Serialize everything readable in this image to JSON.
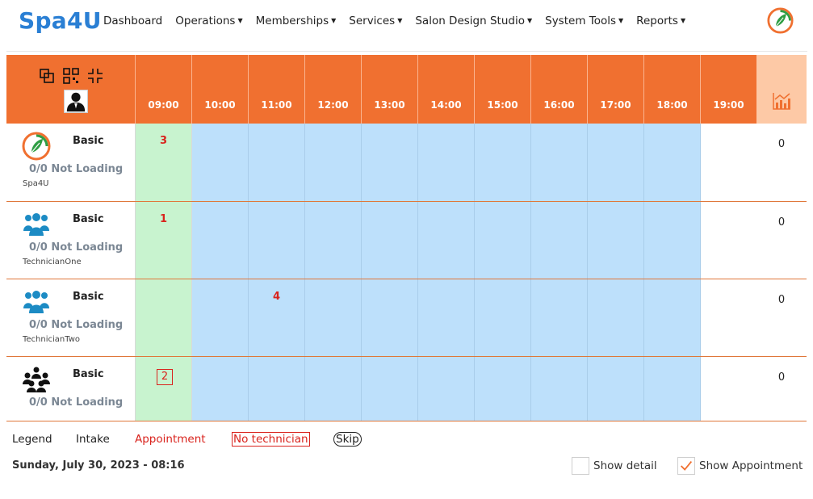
{
  "nav": {
    "brand": "Spa4U",
    "items": [
      "Dashboard",
      "Operations",
      "Memberships",
      "Services",
      "Salon Design Studio",
      "System Tools",
      "Reports"
    ],
    "dropdown": [
      false,
      true,
      true,
      true,
      true,
      true,
      true
    ]
  },
  "schedule": {
    "hours": [
      "09:00",
      "10:00",
      "11:00",
      "12:00",
      "13:00",
      "14:00",
      "15:00",
      "16:00",
      "17:00",
      "18:00",
      "19:00"
    ],
    "rows": [
      {
        "plan": "Basic",
        "status": "0/0 Not Loading",
        "name": "Spa4U",
        "avatar": "spa4u-logo-icon",
        "total": "0",
        "marks": [
          {
            "hour": "09:00",
            "value": "3",
            "style": "appointment"
          }
        ]
      },
      {
        "plan": "Basic",
        "status": "0/0 Not Loading",
        "name": "TechnicianOne",
        "avatar": "group-blue-icon",
        "total": "0",
        "marks": [
          {
            "hour": "09:00",
            "value": "1",
            "style": "appointment"
          }
        ]
      },
      {
        "plan": "Basic",
        "status": "0/0 Not Loading",
        "name": "TechnicianTwo",
        "avatar": "group-blue-icon",
        "total": "0",
        "marks": [
          {
            "hour": "11:00",
            "value": "4",
            "style": "appointment"
          }
        ]
      },
      {
        "plan": "Basic",
        "status": "0/0 Not Loading",
        "name": "",
        "avatar": "group-black-icon",
        "total": "0",
        "marks": [
          {
            "hour": "09:00",
            "value": "2",
            "style": "no-technician"
          }
        ]
      }
    ]
  },
  "legend": {
    "title": "Legend",
    "intake": "Intake",
    "appointment": "Appointment",
    "no_technician": "No technician",
    "skip": "Skip"
  },
  "footer": {
    "datetime": "Sunday, July 30, 2023 - 08:16",
    "show_detail": "Show detail",
    "show_detail_checked": false,
    "show_appointment": "Show Appointment",
    "show_appointment_checked": true
  },
  "colors": {
    "brand": "#2a7fd4",
    "header": "#f07030",
    "intake": "#c8f3cf",
    "busy": "#bde0fb",
    "appointment": "#d9231d"
  }
}
